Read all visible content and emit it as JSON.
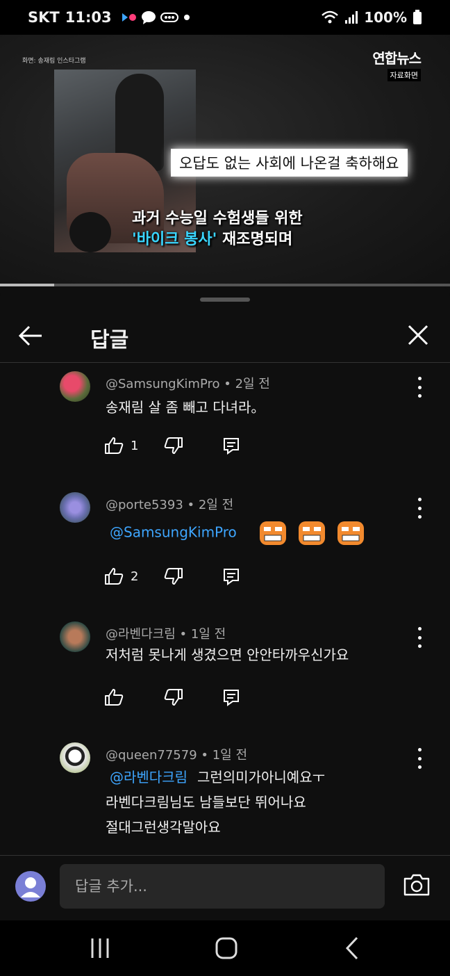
{
  "status_bar": {
    "carrier": "SKT",
    "time": "11:03",
    "battery": "100%"
  },
  "video": {
    "credit": "화면: 송재림 인스타그램",
    "logo_brand": "연합뉴스",
    "logo_sub": "자료화면",
    "caption_top": "오답도 없는 사회에 나온걸 축하해요",
    "caption_line1": "과거 수능일 수험생들 위한",
    "caption_highlight": "'바이크 봉사'",
    "caption_line2_rest": " 재조명되며",
    "progress_fraction": 0.12
  },
  "header": {
    "title": "답글"
  },
  "comments": [
    {
      "meta": "@SamsungKimPro • 2일 전",
      "text": "송재림 살 좀 빼고 다녀라。",
      "likes": "1",
      "avatar_color": "#5a6b3a"
    },
    {
      "meta": "@porte5393 • 2일 전",
      "mention": "@SamsungKimPro",
      "likes": "2",
      "avatar_color": "#6a6fb0"
    },
    {
      "meta": "@라벤다크림 • 1일 전",
      "text": "저처럼 못나게 생겼으면 안안타까우신가요",
      "likes": "",
      "avatar_color": "#2d4a44"
    },
    {
      "meta": "@queen77579 • 1일 전",
      "mention": "@라벤다크림",
      "text_after_mention": "그런의미가아니예요ㅜ",
      "line2": "라벤다크림님도 남들보단 뛰어나요",
      "line3": "절대그런생각말아요",
      "avatar_color": "#e8e8e8"
    }
  ],
  "input": {
    "placeholder": "답글 추가..."
  }
}
